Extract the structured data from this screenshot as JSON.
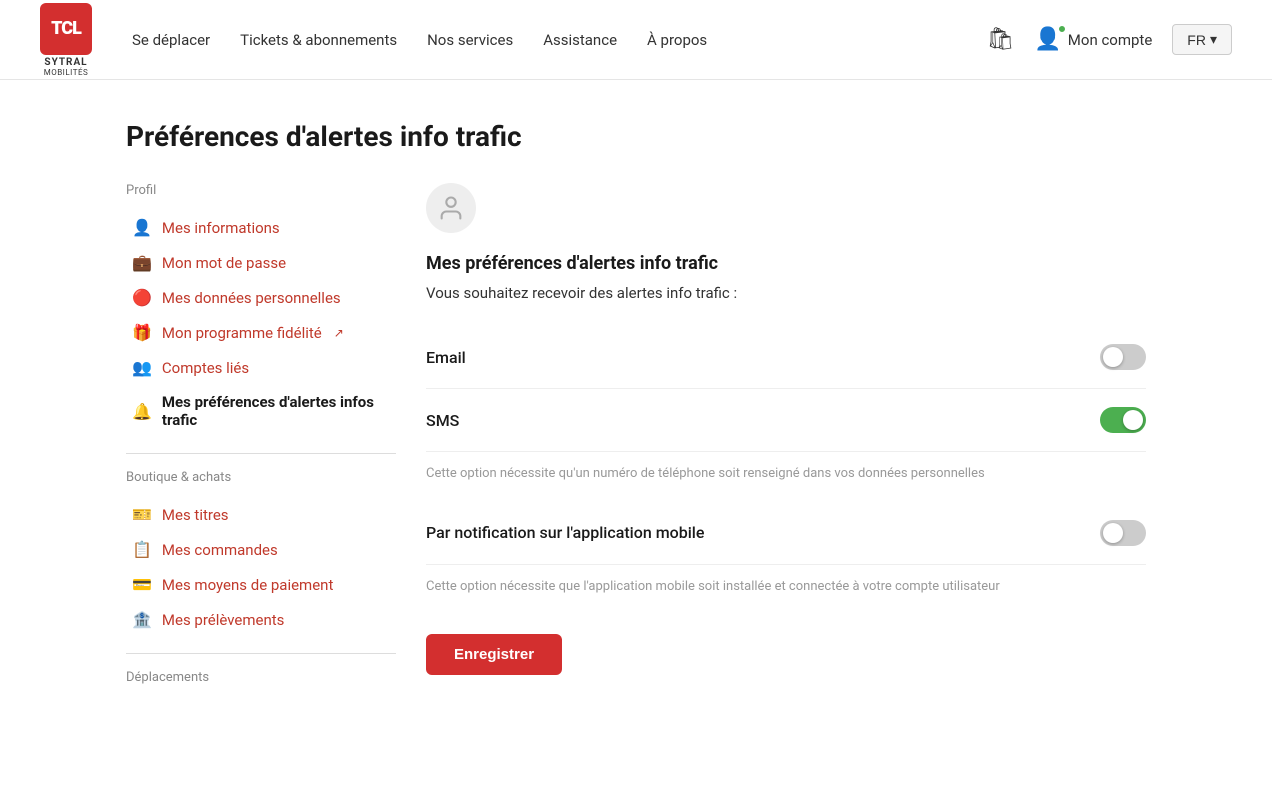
{
  "header": {
    "logo_text": "TCL",
    "logo_brand": "SYTRAL",
    "logo_sub": "MOBILITÉS",
    "nav": {
      "items": [
        {
          "label": "Se déplacer",
          "href": "#"
        },
        {
          "label": "Tickets & abonnements",
          "href": "#"
        },
        {
          "label": "Nos services",
          "href": "#"
        },
        {
          "label": "Assistance",
          "href": "#"
        },
        {
          "label": "À propos",
          "href": "#"
        }
      ]
    },
    "account_label": "Mon compte",
    "lang_label": "FR"
  },
  "page": {
    "title": "Préférences d'alertes info trafic"
  },
  "sidebar": {
    "section1_title": "Profil",
    "items_profil": [
      {
        "label": "Mes informations",
        "icon": "👤",
        "active": false
      },
      {
        "label": "Mon mot de passe",
        "icon": "💼",
        "active": false
      },
      {
        "label": "Mes données personnelles",
        "icon": "🔴",
        "active": false
      },
      {
        "label": "Mon programme fidélité",
        "icon": "🎁",
        "active": false,
        "external": true
      },
      {
        "label": "Comptes liés",
        "icon": "👥",
        "active": false
      },
      {
        "label": "Mes préférences d'alertes infos trafic",
        "icon": "🔔",
        "active": true
      }
    ],
    "section2_title": "Boutique & achats",
    "items_boutique": [
      {
        "label": "Mes titres",
        "icon": "🎫",
        "active": false
      },
      {
        "label": "Mes commandes",
        "icon": "📋",
        "active": false
      },
      {
        "label": "Mes moyens de paiement",
        "icon": "💳",
        "active": false
      },
      {
        "label": "Mes prélèvements",
        "icon": "🏦",
        "active": false
      }
    ],
    "section3_title": "Déplacements"
  },
  "main": {
    "section_title": "Mes préférences d'alertes info trafic",
    "intro_text": "Vous souhaitez recevoir des alertes info trafic :",
    "toggles": [
      {
        "id": "email",
        "label": "Email",
        "enabled": false,
        "note": ""
      },
      {
        "id": "sms",
        "label": "SMS",
        "enabled": true,
        "note": "Cette option nécessite qu'un numéro de téléphone soit renseigné dans vos données personnelles"
      },
      {
        "id": "notif",
        "label": "Par notification sur l'application mobile",
        "enabled": false,
        "note": "Cette option nécessite que l'application mobile soit installée et connectée à votre compte utilisateur"
      }
    ],
    "save_button_label": "Enregistrer"
  }
}
